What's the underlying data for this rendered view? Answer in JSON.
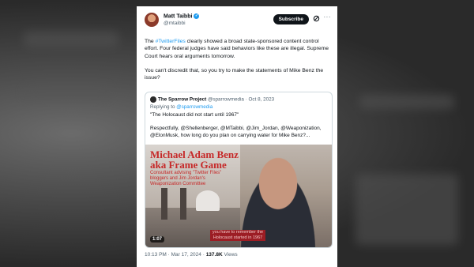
{
  "author": {
    "name": "Matt Taibbi",
    "handle": "@mtaibbi"
  },
  "actions": {
    "subscribe_label": "Subscribe",
    "more_label": "···"
  },
  "tweet": {
    "text_before_tag": "The ",
    "hashtag": "#TwitterFiles",
    "text_after_tag": " clearly showed a broad state-sponsored content control effort. Four federal judges have said behaviors like these are illegal. Supreme Court hears oral arguments tomorrow.",
    "paragraph2": "You can't discredit that, so you try to make the statements of Mike Benz the issue?"
  },
  "quote": {
    "name": "The Sparrow Project",
    "meta": "@sparrowmedia · Oct 8, 2023",
    "replying_prefix": "Replying to ",
    "replying_handle": "@sparrowmedia",
    "line1": "\"The Holocaust did not start until 1967\"",
    "line2": "Respectfully, @Shellenberger, @MTaibbi, @Jim_Jordan, @Weaponization, @ElonMusk, how long do you plan on carrying water for Mike Benz?...",
    "video": {
      "title_line1": "Michael Adam Benz",
      "title_line2": "aka Frame Game",
      "subtitle": "Consultant advising \"Twitter Files\" bloggers and Jim Jordan's Weaponization Committee",
      "caption": "you have to remember the Holocaust started in 1967",
      "duration": "1:07"
    }
  },
  "footer": {
    "timestamp": "10:13 PM · Mar 17, 2024 · ",
    "views_count": "137.8K",
    "views_label": " Views"
  }
}
